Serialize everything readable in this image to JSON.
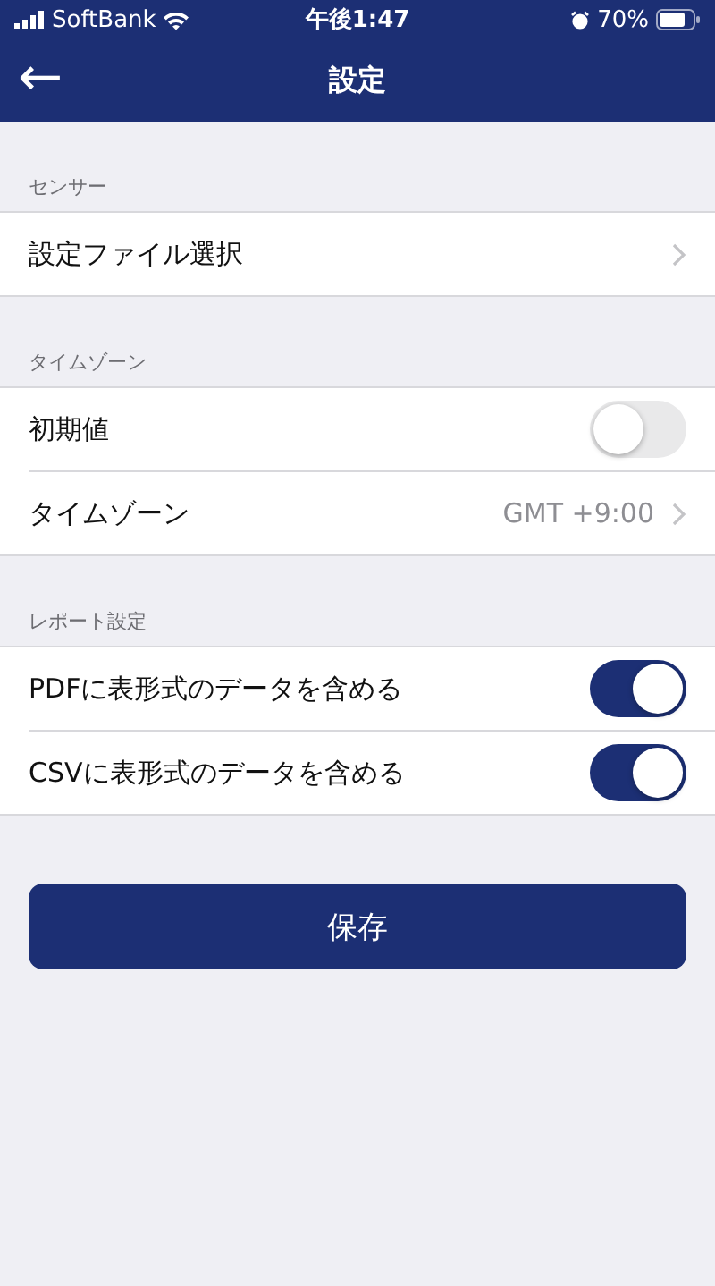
{
  "status_bar": {
    "carrier": "SoftBank",
    "time": "午後1:47",
    "battery": "70%"
  },
  "nav": {
    "title": "設定",
    "back_arrow": "←"
  },
  "sections": [
    {
      "header": "センサー",
      "rows": [
        {
          "kind": "link",
          "label": "設定ファイル選択"
        }
      ]
    },
    {
      "header": "タイムゾーン",
      "rows": [
        {
          "kind": "toggle",
          "label": "初期値",
          "on": false
        },
        {
          "kind": "link",
          "label": "タイムゾーン",
          "value": "GMT +9:00"
        }
      ]
    },
    {
      "header": "レポート設定",
      "rows": [
        {
          "kind": "toggle",
          "label": "PDFに表形式のデータを含める",
          "on": true
        },
        {
          "kind": "toggle",
          "label": "CSVに表形式のデータを含める",
          "on": true
        }
      ]
    }
  ],
  "save_button": "保存"
}
